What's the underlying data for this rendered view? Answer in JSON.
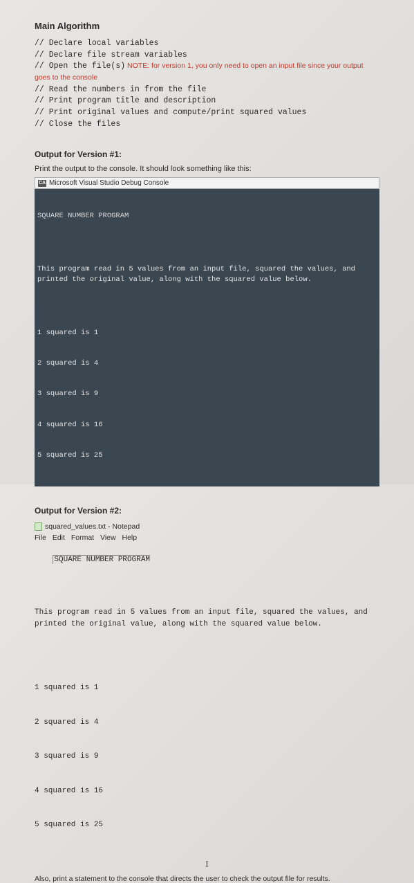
{
  "main_heading": "Main Algorithm",
  "comments": [
    "// Declare local variables",
    "// Declare file stream variables",
    "// Open the file(s)",
    "// Read the numbers in from the file",
    "// Print program title and description",
    "// Print original values and compute/print squared values",
    "// Close the files"
  ],
  "comment_note_prefix": " NOTE: ",
  "comment_note": "for version 1, you only need to open an input file since your output goes to the console",
  "v1": {
    "heading": "Output for Version #1:",
    "intro": "Print the output to the console. It should look something like this:",
    "titlebar_icon": "CA",
    "titlebar": "Microsoft Visual Studio Debug Console",
    "program_title": "SQUARE NUMBER PROGRAM",
    "desc": "This program read in 5 values from an input file, squared the values, and\nprinted the original value, along with the squared value below.",
    "lines": [
      "1 squared is 1",
      "2 squared is 4",
      "3 squared is 9",
      "4 squared is 16",
      "5 squared is 25"
    ]
  },
  "v2": {
    "heading": "Output for Version #2:",
    "titlebar": "squared_values.txt - Notepad",
    "menubar": "File  Edit  Format  View  Help",
    "program_title": "SQUARE NUMBER PROGRAM",
    "desc": "This program read in 5 values from an input file, squared the values, and\nprinted the original value, along with the squared value below.",
    "lines": [
      "1 squared is 1",
      "2 squared is 4",
      "3 squared is 9",
      "4 squared is 16",
      "5 squared is 25"
    ]
  },
  "cursor": "I",
  "footer": "Also, print a statement to the console that directs the user to check the output file for results."
}
